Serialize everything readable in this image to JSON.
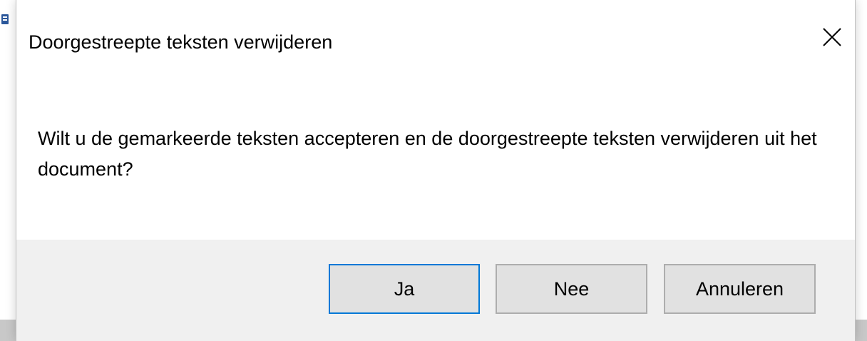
{
  "dialog": {
    "title": "Doorgestreepte teksten verwijderen",
    "message": "Wilt u de gemarkeerde teksten accepteren en de doorgestreepte teksten verwijderen uit het document?",
    "close_icon": "close-icon",
    "buttons": {
      "yes_label": "Ja",
      "no_label": "Nee",
      "cancel_label": "Annuleren"
    }
  },
  "background": {
    "app_icon": "word-document-icon"
  },
  "colors": {
    "focus_border": "#0078d7",
    "button_face": "#e1e1e1",
    "footer_bg": "#f0f0f0"
  }
}
